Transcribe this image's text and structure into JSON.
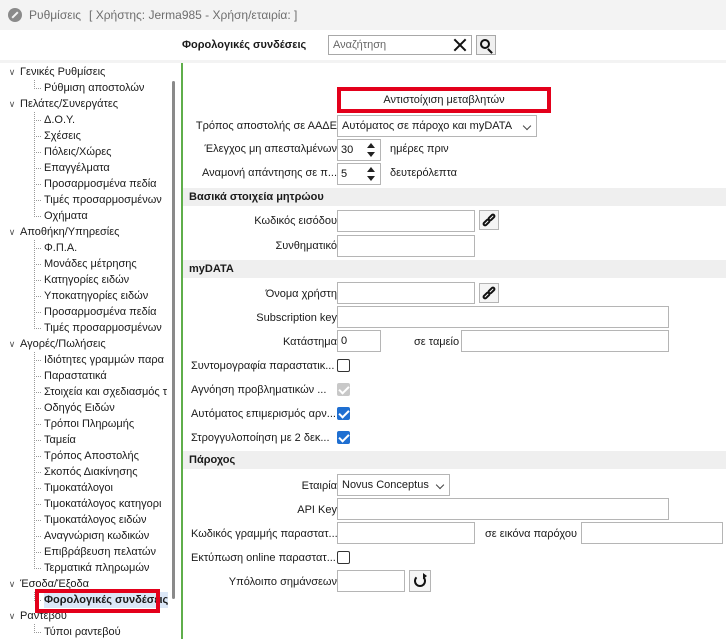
{
  "window": {
    "title": "Ρυθμίσεις",
    "subtitle": "[ Χρήστης: Jerma985 - Χρήση/εταιρία: ]"
  },
  "header": {
    "label": "Φορολογικές συνδέσεις",
    "search_placeholder": "Αναζήτηση"
  },
  "tree": {
    "groups": [
      {
        "label": "Γενικές Ρυθμίσεις",
        "children": [
          "Ρύθμιση αποστολών"
        ]
      },
      {
        "label": "Πελάτες/Συνεργάτες",
        "children": [
          "Δ.Ο.Υ.",
          "Σχέσεις",
          "Πόλεις/Χώρες",
          "Επαγγέλματα",
          "Προσαρμοσμένα πεδία",
          "Τιμές προσαρμοσμένων",
          "Οχήματα"
        ]
      },
      {
        "label": "Αποθήκη/Υπηρεσίες",
        "children": [
          "Φ.Π.Α.",
          "Μονάδες μέτρησης",
          "Κατηγορίες ειδών",
          "Υποκατηγορίες ειδών",
          "Προσαρμοσμένα πεδία",
          "Τιμές προσαρμοσμένων"
        ]
      },
      {
        "label": "Αγορές/Πωλήσεις",
        "children": [
          "Ιδιότητες γραμμών παρα",
          "Παραστατικά",
          "Στοιχεία και σχεδιασμός τ",
          "Οδηγός Ειδών",
          "Τρόποι Πληρωμής",
          "Ταμεία",
          "Τρόπος Αποστολής",
          "Σκοπός Διακίνησης",
          "Τιμοκατάλογοι",
          "Τιμοκατάλογος κατηγορι",
          "Τιμοκατάλογος ειδών",
          "Αναγνώριση κωδικών",
          "Επιβράβευση πελατών",
          "Τερματικά πληρωμών"
        ]
      },
      {
        "label": "Έσοδα/Έξοδα",
        "children": [
          "Φορολογικές συνδέσεις"
        ]
      },
      {
        "label": "Ραντεβού",
        "children": [
          "Τύποι ραντεβού"
        ]
      }
    ],
    "selected": "Φορολογικές συνδέσεις"
  },
  "form": {
    "map_button": "Αντιστοίχιση μεταβλητών",
    "send_mode_label": "Τρόπος αποστολής σε ΑΑΔΕ",
    "send_mode_value": "Αυτόματος σε πάροχο και myDATA",
    "check_unsent_label": "Έλεγχος μη απεσταλμένων",
    "check_unsent_value": "30",
    "check_unsent_unit": "ημέρες πριν",
    "wait_label": "Αναμονή απάντησης σε π...",
    "wait_value": "5",
    "wait_unit": "δευτερόλεπτα",
    "section_registry": "Βασικά στοιχεία μητρώου",
    "login_code_label": "Κωδικός εισόδου",
    "password_label": "Συνθηματικό",
    "section_mydata": "myDATA",
    "username_label": "Όνομα χρήστη",
    "subscription_label": "Subscription key",
    "branch_label": "Κατάστημα",
    "branch_value": "0",
    "cash_register_label": "σε ταμείο",
    "abbrev_label": "Συντομογραφία παραστατικ...",
    "ignore_label": "Αγνόηση προβληματικών ...",
    "auto_split_label": "Αυτόματος επιμερισμός αρν...",
    "round_label": "Στρογγυλοποίηση με 2 δεκ...",
    "section_provider": "Πάροχος",
    "company_label": "Εταιρία",
    "company_value": "Novus Conceptus",
    "api_key_label": "API Key",
    "line_code_label": "Κωδικός γραμμής παραστατ...",
    "provider_image_label": "σε εικόνα παρόχου",
    "online_print_label": "Εκτύπωση online παραστατ...",
    "balance_label": "Υπόλοιπο σημάνσεων"
  },
  "colors": {
    "highlight": "#e3001b",
    "checkbox_on": "#1f6fd1",
    "accent_edge": "#5fae4b"
  }
}
